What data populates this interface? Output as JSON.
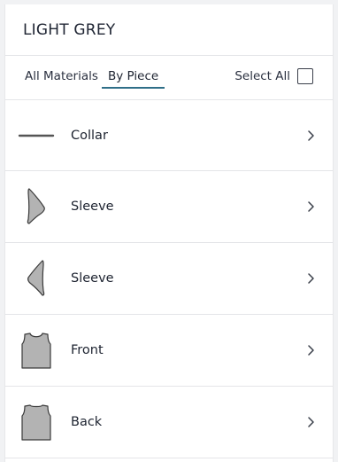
{
  "header": {
    "title": "LIGHT GREY"
  },
  "tabs": {
    "all_materials": "All Materials",
    "by_piece": "By Piece",
    "active": "by_piece"
  },
  "select_all": {
    "label": "Select All",
    "checked": false
  },
  "pieces": [
    {
      "label": "Collar",
      "icon": "collar-icon"
    },
    {
      "label": "Sleeve",
      "icon": "sleeve-icon"
    },
    {
      "label": "Sleeve",
      "icon": "sleeve-icon"
    },
    {
      "label": "Front",
      "icon": "front-bodice-icon"
    },
    {
      "label": "Back",
      "icon": "back-bodice-icon"
    }
  ],
  "colors": {
    "tab_underline": "#2f6f88",
    "piece_fill": "#b3b3b3",
    "piece_stroke": "#3a3a3a"
  }
}
